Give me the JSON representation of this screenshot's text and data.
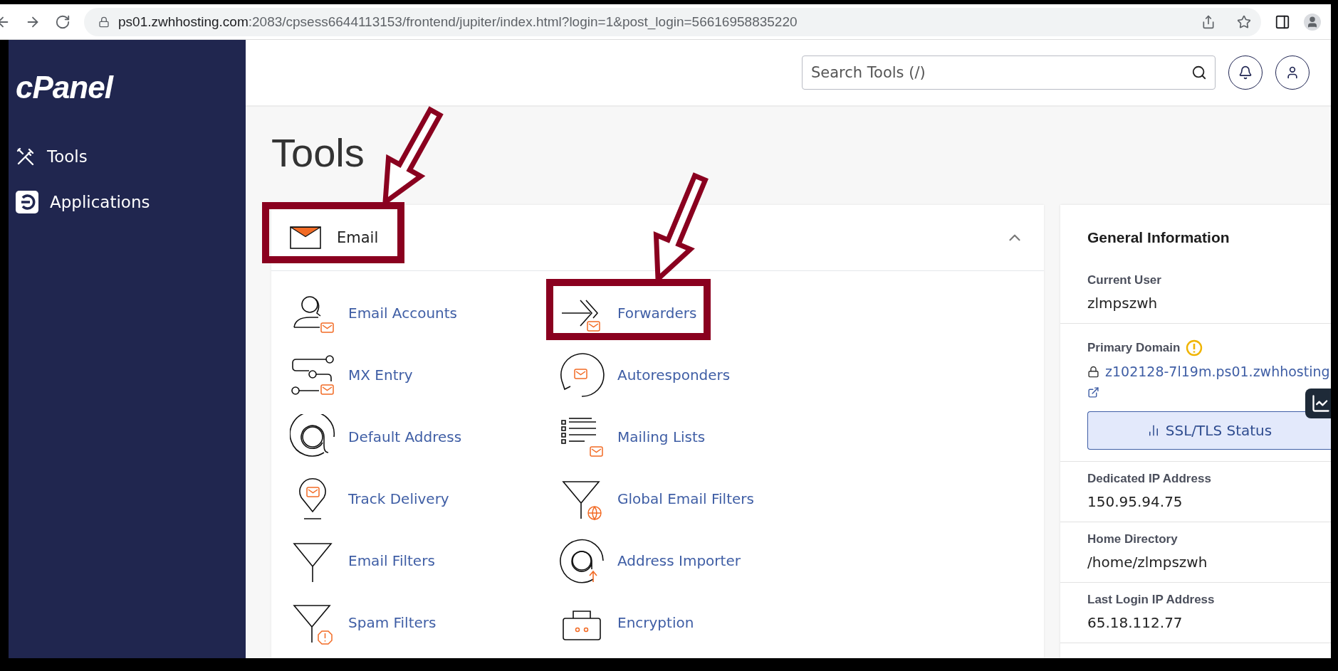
{
  "browser": {
    "url_host": "ps01.zwhhosting.com",
    "url_path": ":2083/cpsess6644113153/frontend/jupiter/index.html?login=1&post_login=56616958835220"
  },
  "sidebar": {
    "logo": "cPanel",
    "items": [
      {
        "label": "Tools",
        "kind": "tools"
      },
      {
        "label": "Applications",
        "kind": "applications"
      }
    ]
  },
  "header": {
    "search": {
      "placeholder": "Search Tools (/)"
    }
  },
  "page_title": "Tools",
  "email_section": {
    "title": "Email",
    "expanded": true,
    "tools": [
      {
        "label": "Email Accounts",
        "kind": "accounts"
      },
      {
        "label": "Forwarders",
        "kind": "forwarders"
      },
      {
        "label": "MX Entry",
        "kind": "mx"
      },
      {
        "label": "Autoresponders",
        "kind": "autoresponders"
      },
      {
        "label": "Default Address",
        "kind": "at"
      },
      {
        "label": "Mailing Lists",
        "kind": "lists"
      },
      {
        "label": "Track Delivery",
        "kind": "track"
      },
      {
        "label": "Global Email Filters",
        "kind": "global_filter"
      },
      {
        "label": "Email Filters",
        "kind": "filter"
      },
      {
        "label": "Address Importer",
        "kind": "importer"
      },
      {
        "label": "Spam Filters",
        "kind": "spam"
      },
      {
        "label": "Encryption",
        "kind": "encryption"
      }
    ]
  },
  "general_information": {
    "title": "General Information",
    "fields": [
      {
        "kind": "text",
        "label": "Current User",
        "value": "zlmpszwh"
      },
      {
        "kind": "domain",
        "label": "Primary Domain",
        "warning": true,
        "value": "z102128-7l19m.ps01.zwhhosting",
        "button": "SSL/TLS Status"
      },
      {
        "kind": "text",
        "label": "Dedicated IP Address",
        "value": "150.95.94.75"
      },
      {
        "kind": "text",
        "label": "Home Directory",
        "value": "/home/zlmpszwh"
      },
      {
        "kind": "text",
        "label": "Last Login IP Address",
        "value": "65.18.112.77"
      }
    ]
  }
}
